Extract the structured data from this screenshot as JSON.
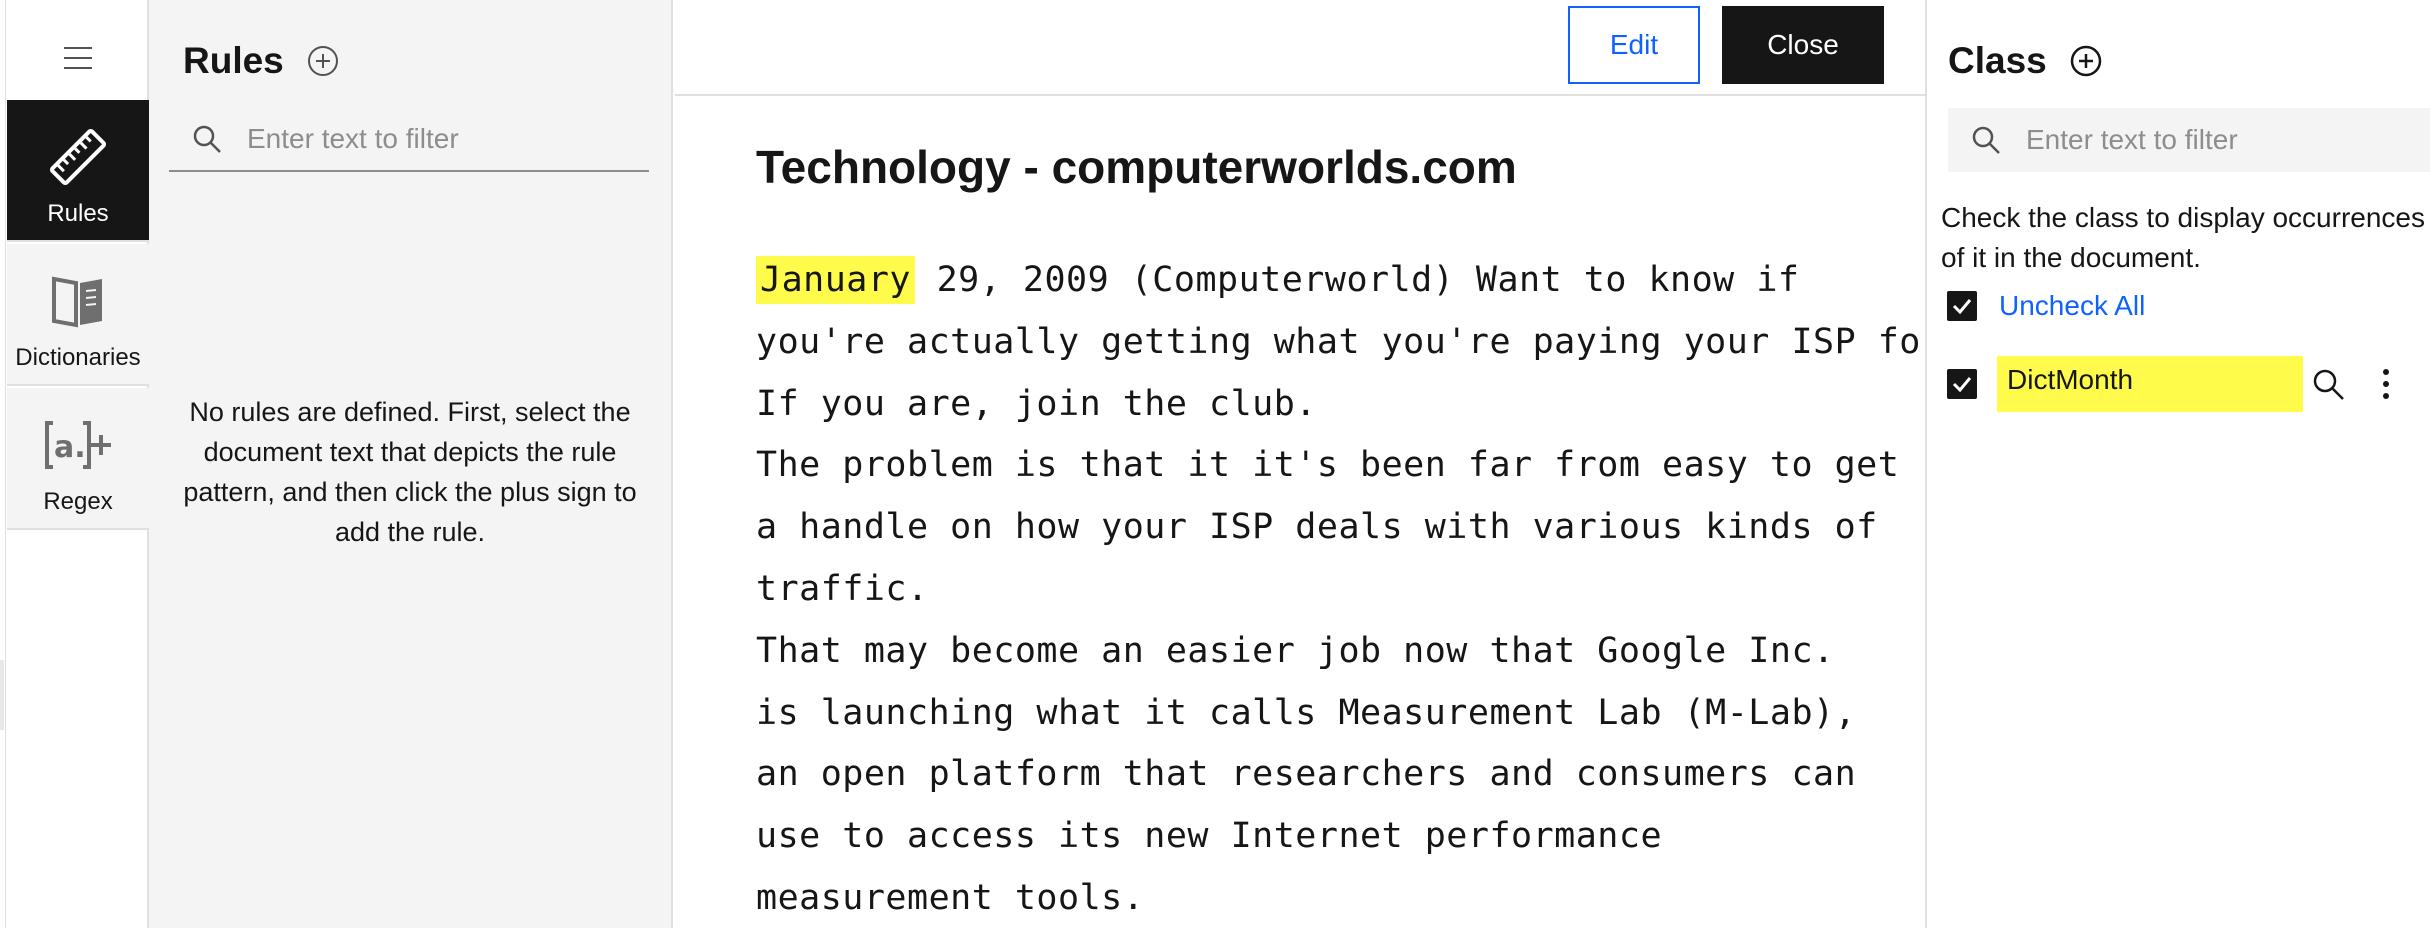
{
  "nav": {
    "items": [
      {
        "label": "Rules",
        "icon": "ruler-icon",
        "active": true
      },
      {
        "label": "Dictionaries",
        "icon": "book-icon",
        "active": false
      },
      {
        "label": "Regex",
        "icon": "regex-icon",
        "active": false
      }
    ]
  },
  "rules_panel": {
    "title": "Rules",
    "filter_placeholder": "Enter text to filter",
    "empty_message": "No rules are defined. First, select the document text that depicts the rule pattern, and then click the plus sign to add the rule."
  },
  "document": {
    "edit_label": "Edit",
    "close_label": "Close",
    "title": "Technology - computerworlds.com",
    "highlight_word": "January",
    "line1_rest": " 29, 2009 (Computerworld) Want to know if",
    "line2": "you're actually getting what you're paying your ISP for?",
    "line3": "If you are, join the club.",
    "line4": "The problem is that it it's been far from easy to get",
    "line5": "a handle on how your ISP deals with various kinds of",
    "line6": "traffic.",
    "line7": "That may become an easier job now that Google Inc.",
    "line8": "is launching what it calls Measurement Lab (M-Lab),",
    "line9": "an open platform that researchers and consumers can",
    "line10": "use to access its new Internet performance",
    "line11": "measurement tools."
  },
  "class_panel": {
    "title": "Class",
    "filter_placeholder": "Enter text to filter",
    "hint": "Check the class to display occurrences of it in the document.",
    "uncheck_all_label": "Uncheck All",
    "classes": [
      {
        "label": "DictMonth",
        "checked": true,
        "highlight_color": "#fefb4b"
      }
    ]
  },
  "colors": {
    "accent": "#0f62fe",
    "highlight": "#fefb4b",
    "dark": "#161616",
    "panel_bg": "#f4f4f4"
  }
}
